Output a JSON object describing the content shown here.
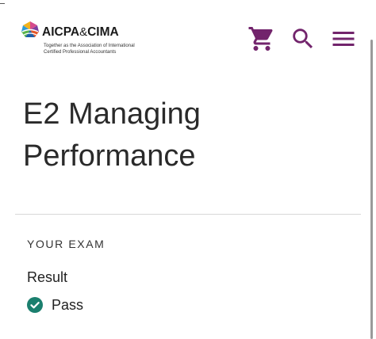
{
  "header": {
    "brand_name_left": "AICPA",
    "brand_ampersand": "&",
    "brand_name_right": "CIMA",
    "tagline_line1": "Together as the Association of International",
    "tagline_line2": "Certified Professional Accountants",
    "icons": {
      "cart": "shopping-cart-icon",
      "search": "search-icon",
      "menu": "hamburger-menu-icon"
    },
    "accent_color": "#72246c"
  },
  "main": {
    "title_line1": "E2 Managing",
    "title_line2": "Performance",
    "section_label": "YOUR EXAM",
    "result_heading": "Result",
    "result_value": "Pass",
    "result_icon": "check-circle-icon",
    "status_color": "#1b7f6e"
  }
}
